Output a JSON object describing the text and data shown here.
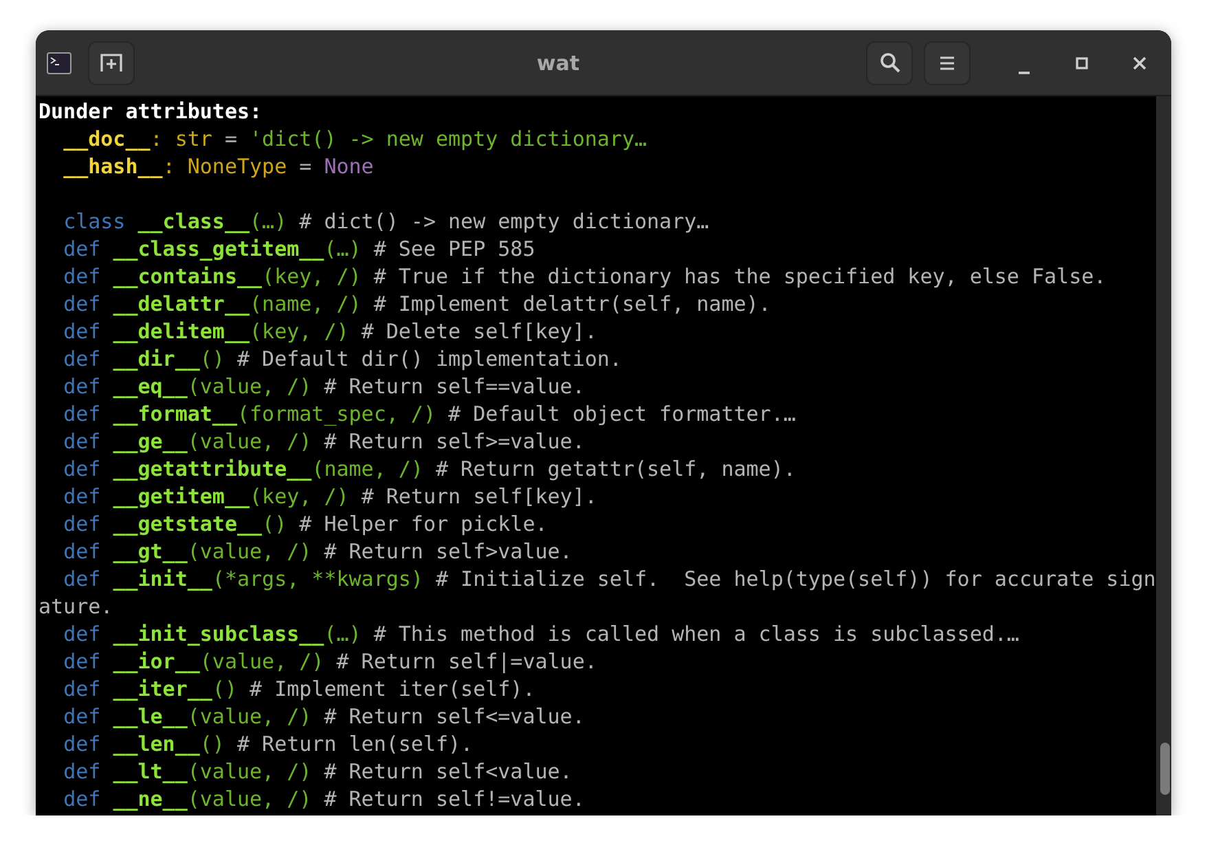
{
  "window": {
    "title": "wat"
  },
  "lines": [
    {
      "kind": "header",
      "text": "Dunder attributes:"
    },
    {
      "kind": "attribute",
      "segments": [
        {
          "kind": "name",
          "text": "__doc__"
        },
        {
          "kind": "colon",
          "text": ":"
        },
        {
          "kind": "type",
          "text": "str"
        },
        {
          "kind": "operator",
          "text": "="
        },
        {
          "kind": "string",
          "text": "'dict() -> new empty dictionary…"
        }
      ]
    },
    {
      "kind": "attribute",
      "segments": [
        {
          "kind": "name",
          "text": "__hash__"
        },
        {
          "kind": "colon",
          "text": ":"
        },
        {
          "kind": "type",
          "text": "NoneType"
        },
        {
          "kind": "operator",
          "text": "="
        },
        {
          "kind": "none",
          "text": "None"
        }
      ]
    },
    {
      "kind": "blank"
    },
    {
      "kind": "method",
      "keyword": "class",
      "name": "__class__",
      "args": "(…)",
      "comment": "# dict() -> new empty dictionary…"
    },
    {
      "kind": "method",
      "keyword": "def",
      "name": "__class_getitem__",
      "args": "(…)",
      "comment": "# See PEP 585"
    },
    {
      "kind": "method",
      "keyword": "def",
      "name": "__contains__",
      "args": "(key, /)",
      "comment": "# True if the dictionary has the specified key, else False."
    },
    {
      "kind": "method",
      "keyword": "def",
      "name": "__delattr__",
      "args": "(name, /)",
      "comment": "# Implement delattr(self, name)."
    },
    {
      "kind": "method",
      "keyword": "def",
      "name": "__delitem__",
      "args": "(key, /)",
      "comment": "# Delete self[key]."
    },
    {
      "kind": "method",
      "keyword": "def",
      "name": "__dir__",
      "args": "()",
      "comment": "# Default dir() implementation."
    },
    {
      "kind": "method",
      "keyword": "def",
      "name": "__eq__",
      "args": "(value, /)",
      "comment": "# Return self==value."
    },
    {
      "kind": "method",
      "keyword": "def",
      "name": "__format__",
      "args": "(format_spec, /)",
      "comment": "# Default object formatter.…"
    },
    {
      "kind": "method",
      "keyword": "def",
      "name": "__ge__",
      "args": "(value, /)",
      "comment": "# Return self>=value."
    },
    {
      "kind": "method",
      "keyword": "def",
      "name": "__getattribute__",
      "args": "(name, /)",
      "comment": "# Return getattr(self, name)."
    },
    {
      "kind": "method",
      "keyword": "def",
      "name": "__getitem__",
      "args": "(key, /)",
      "comment": "# Return self[key]."
    },
    {
      "kind": "method",
      "keyword": "def",
      "name": "__getstate__",
      "args": "()",
      "comment": "# Helper for pickle."
    },
    {
      "kind": "method",
      "keyword": "def",
      "name": "__gt__",
      "args": "(value, /)",
      "comment": "# Return self>value."
    },
    {
      "kind": "method",
      "keyword": "def",
      "name": "__init__",
      "args": "(*args, **kwargs)",
      "comment": "# Initialize self.  See help(type(self)) for accurate sign"
    },
    {
      "kind": "wrap",
      "text": "ature."
    },
    {
      "kind": "method",
      "keyword": "def",
      "name": "__init_subclass__",
      "args": "(…)",
      "comment": "# This method is called when a class is subclassed.…"
    },
    {
      "kind": "method",
      "keyword": "def",
      "name": "__ior__",
      "args": "(value, /)",
      "comment": "# Return self|=value."
    },
    {
      "kind": "method",
      "keyword": "def",
      "name": "__iter__",
      "args": "()",
      "comment": "# Implement iter(self)."
    },
    {
      "kind": "method",
      "keyword": "def",
      "name": "__le__",
      "args": "(value, /)",
      "comment": "# Return self<=value."
    },
    {
      "kind": "method",
      "keyword": "def",
      "name": "__len__",
      "args": "()",
      "comment": "# Return len(self)."
    },
    {
      "kind": "method",
      "keyword": "def",
      "name": "__lt__",
      "args": "(value, /)",
      "comment": "# Return self<value."
    },
    {
      "kind": "method",
      "keyword": "def",
      "name": "__ne__",
      "args": "(value, /)",
      "comment": "# Return self!=value."
    }
  ]
}
